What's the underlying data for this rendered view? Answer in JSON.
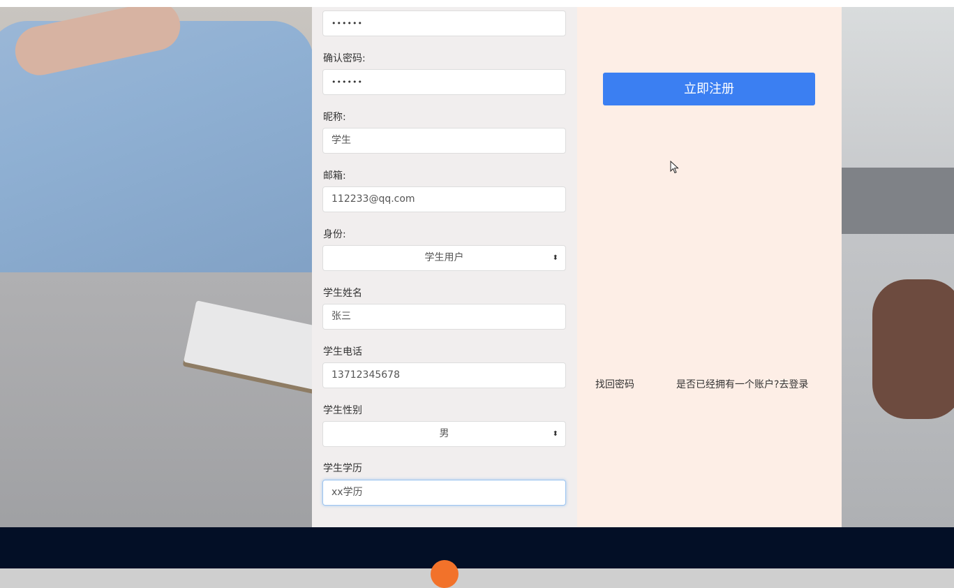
{
  "form": {
    "password_value": "••••••",
    "confirm_password_label": "确认密码:",
    "confirm_password_value": "••••••",
    "nickname_label": "昵称:",
    "nickname_value": "学生",
    "email_label": "邮箱:",
    "email_value": "112233@qq.com",
    "identity_label": "身份:",
    "identity_value": "学生用户",
    "student_name_label": "学生姓名",
    "student_name_value": "张三",
    "student_phone_label": "学生电话",
    "student_phone_value": "13712345678",
    "student_gender_label": "学生性别",
    "student_gender_value": "男",
    "student_education_label": "学生学历",
    "student_education_value": "xx学历"
  },
  "actions": {
    "register_label": "立即注册",
    "forgot_password_label": "找回密码",
    "login_link_label": "是否已经拥有一个账户?去登录"
  },
  "icons": {
    "select_arrow": "⬍"
  },
  "colors": {
    "accent": "#3b7ff2",
    "footer_bg": "#030f26"
  }
}
